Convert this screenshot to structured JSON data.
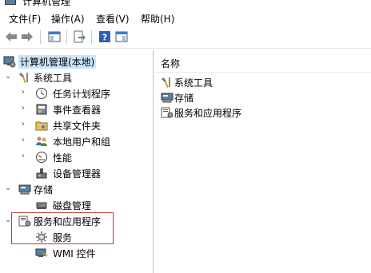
{
  "window": {
    "title": "计算机管理"
  },
  "menu": [
    {
      "label": "文件(F)"
    },
    {
      "label": "操作(A)"
    },
    {
      "label": "查看(V)"
    },
    {
      "label": "帮助(H)"
    }
  ],
  "tree": {
    "root": "计算机管理(本地)",
    "system_tools": "系统工具",
    "task_scheduler": "任务计划程序",
    "event_viewer": "事件查看器",
    "shared_folders": "共享文件夹",
    "local_users": "本地用户和组",
    "performance": "性能",
    "device_manager": "设备管理器",
    "storage": "存储",
    "disk_management": "磁盘管理",
    "services_apps": "服务和应用程序",
    "services": "服务",
    "wmi": "WMI 控件"
  },
  "list": {
    "header": "名称",
    "items": [
      {
        "label": "系统工具"
      },
      {
        "label": "存储"
      },
      {
        "label": "服务和应用程序"
      }
    ]
  }
}
